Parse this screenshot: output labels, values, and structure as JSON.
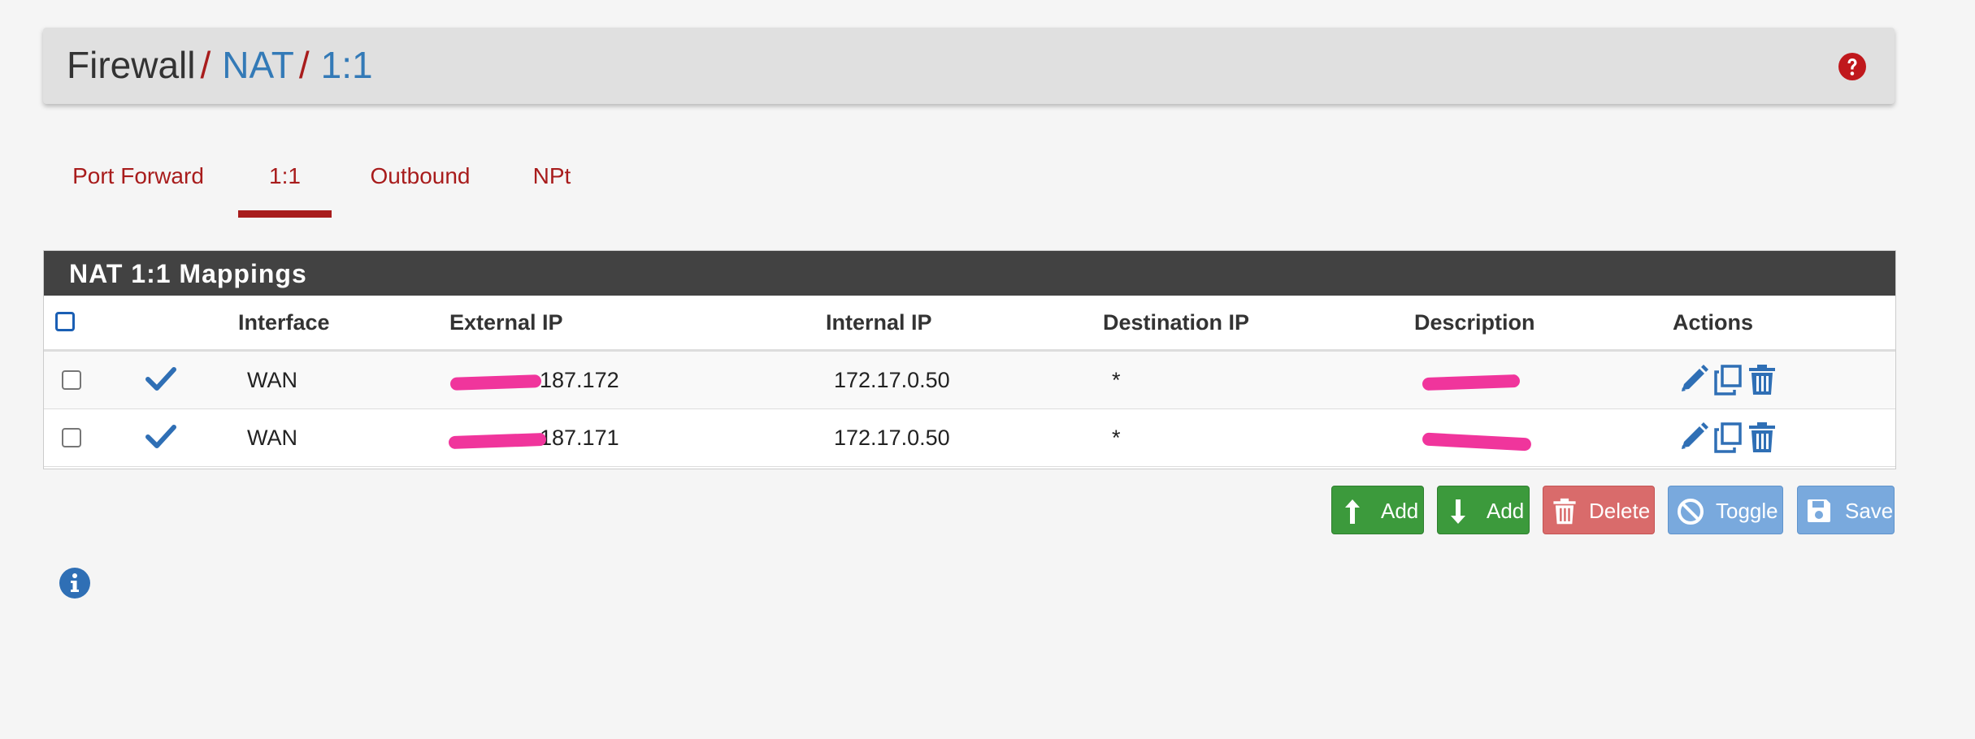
{
  "breadcrumb": {
    "root": "Firewall",
    "sep1": "/",
    "item1": "NAT",
    "sep2": "/",
    "item2": "1:1"
  },
  "tabs": [
    {
      "label": "Port Forward",
      "active": false
    },
    {
      "label": "1:1",
      "active": true
    },
    {
      "label": "Outbound",
      "active": false
    },
    {
      "label": "NPt",
      "active": false
    }
  ],
  "panel": {
    "title": "NAT 1:1 Mappings",
    "columns": [
      "Interface",
      "External IP",
      "Internal IP",
      "Destination IP",
      "Description",
      "Actions"
    ],
    "rows": [
      {
        "enabled": true,
        "interface": "WAN",
        "external_ip": "187.172",
        "internal_ip": "172.17.0.50",
        "destination_ip": "*",
        "description": ""
      },
      {
        "enabled": true,
        "interface": "WAN",
        "external_ip": "187.171",
        "internal_ip": "172.17.0.50",
        "destination_ip": "*",
        "description": ""
      }
    ]
  },
  "buttons": {
    "add_top": "Add",
    "add_bottom": "Add",
    "delete": "Delete",
    "toggle": "Toggle",
    "save": "Save"
  },
  "icons": {
    "help": "question-circle-icon",
    "enabled": "check-icon",
    "edit": "pencil-icon",
    "copy": "copy-icon",
    "delete": "trash-icon",
    "info": "info-circle-icon"
  },
  "colors": {
    "brand_red": "#a81c1c",
    "link_blue": "#337ab7",
    "panel_heading": "#424242",
    "success": "#3c9a3c",
    "danger": "#d96b6b",
    "info": "#79a9dd",
    "redaction": "#f0359c"
  }
}
